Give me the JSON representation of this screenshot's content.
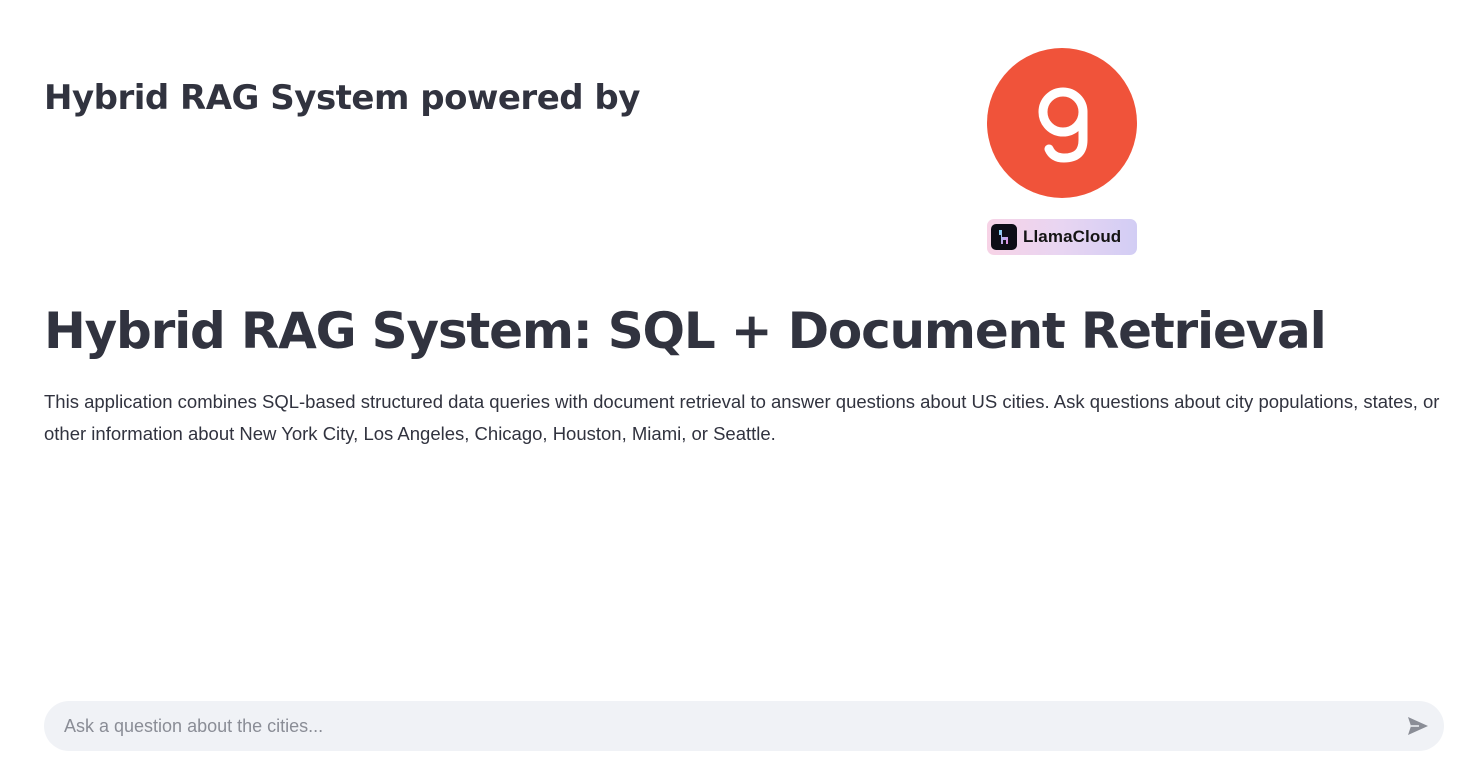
{
  "header": {
    "title": "Hybrid RAG System powered by",
    "logo_icon": "ninetyone-logo",
    "logo_color": "#f0533a",
    "badge": {
      "icon": "llama-icon",
      "label": "LlamaCloud"
    }
  },
  "main": {
    "title": "Hybrid RAG System: SQL + Document Retrieval",
    "description": "This application combines SQL-based structured data queries with document retrieval to answer questions about US cities. Ask questions about city populations, states, or other information about New York City, Los Angeles, Chicago, Houston, Miami, or Seattle."
  },
  "chat": {
    "input_value": "",
    "placeholder": "Ask a question about the cities...",
    "send_icon": "send-icon"
  },
  "colors": {
    "text": "#31333f",
    "chat_background": "#f0f2f6",
    "placeholder": "#8a8d96"
  }
}
